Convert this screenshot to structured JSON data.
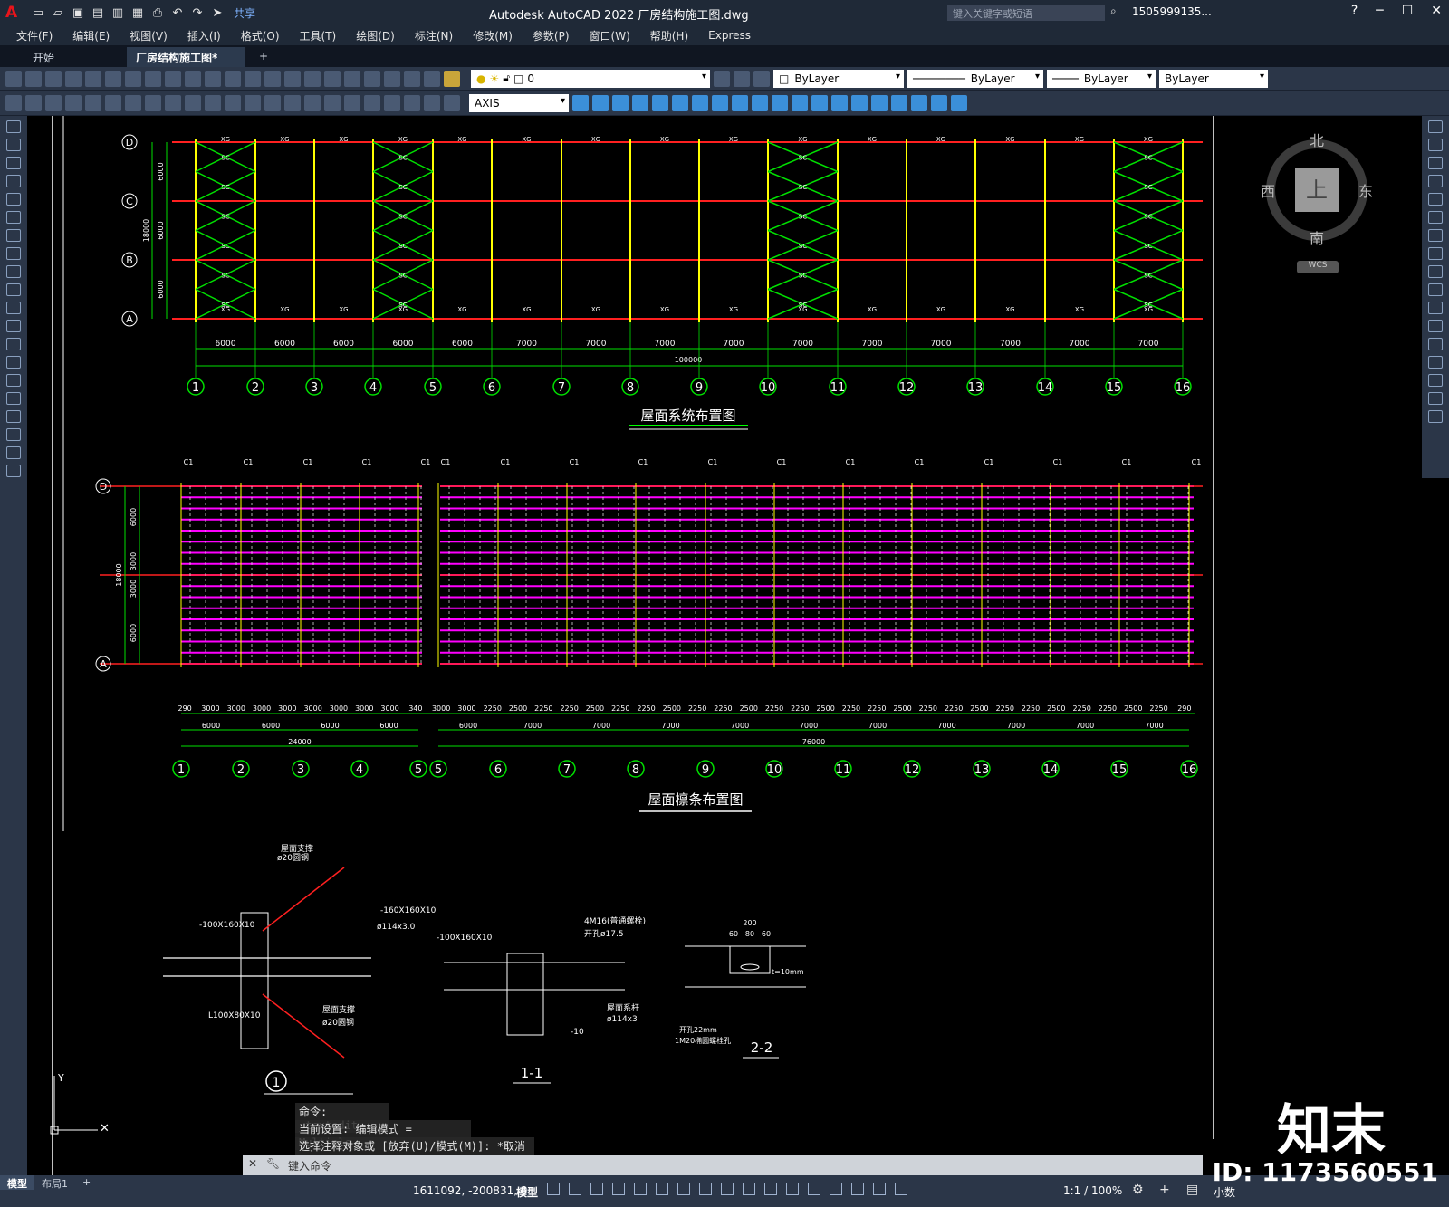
{
  "app": {
    "logo": "A",
    "title": "Autodesk AutoCAD 2022    厂房结构施工图.dwg",
    "search_placeholder": "键入关键字或短语",
    "user": "1505999135...",
    "share": "共享"
  },
  "menu": [
    "文件(F)",
    "编辑(E)",
    "视图(V)",
    "插入(I)",
    "格式(O)",
    "工具(T)",
    "绘图(D)",
    "标注(N)",
    "修改(M)",
    "参数(P)",
    "窗口(W)",
    "帮助(H)",
    "Express"
  ],
  "tabs": {
    "start": "开始",
    "doc": "厂房结构施工图*",
    "close": "✕",
    "add": "+"
  },
  "props": {
    "layer": "0",
    "color": "ByLayer",
    "linetype": "ByLayer",
    "lineweight": "ByLayer",
    "plotstyle": "ByLayer",
    "style": "AXIS"
  },
  "viewcube": {
    "north": "北",
    "south": "南",
    "east": "东",
    "west": "西",
    "top": "上",
    "wcs": "WCS"
  },
  "drawing": {
    "plan1": {
      "title": "屋面系统布置图",
      "rows": [
        "D",
        "C",
        "B",
        "A"
      ],
      "row_dims": [
        "6000",
        "6000",
        "6000"
      ],
      "total_height": "18000",
      "spans": [
        "6000",
        "6000",
        "6000",
        "6000",
        "6000",
        "7000",
        "7000",
        "7000",
        "7000",
        "7000",
        "7000",
        "7000",
        "7000",
        "7000",
        "7000"
      ],
      "total": "100000",
      "axes": [
        "1",
        "2",
        "3",
        "4",
        "5",
        "6",
        "7",
        "8",
        "9",
        "10",
        "11",
        "12",
        "13",
        "14",
        "15",
        "16"
      ]
    },
    "plan2": {
      "title": "屋面檩条布置图",
      "rows": [
        "D",
        "A"
      ],
      "row_dims": [
        "6000",
        "3000",
        "3000",
        "6000"
      ],
      "total_height": "18000",
      "sub_dims": [
        "290",
        "3000",
        "3000",
        "3000",
        "3000",
        "3000",
        "3000",
        "3000",
        "3000",
        "340",
        "3000",
        "3000",
        "2250",
        "2500",
        "2250",
        "2250",
        "2500",
        "2250",
        "2250",
        "2500",
        "2250",
        "2250",
        "2500",
        "2250",
        "2250",
        "2500",
        "2250",
        "2250",
        "2500",
        "2250",
        "2250",
        "2500",
        "2250",
        "2250",
        "2500",
        "2250",
        "2250",
        "2500",
        "2250",
        "290"
      ],
      "spans_left": [
        "6000",
        "6000",
        "6000",
        "6000"
      ],
      "spans_right": [
        "6000",
        "7000",
        "7000",
        "7000",
        "7000",
        "7000",
        "7000",
        "7000",
        "7000",
        "7000",
        "7000"
      ],
      "total_left": "24000",
      "total_right": "76000",
      "axes_left": [
        "1",
        "2",
        "3",
        "4",
        "5"
      ],
      "axes_right": [
        "5",
        "6",
        "7",
        "8",
        "9",
        "10",
        "11",
        "12",
        "13",
        "14",
        "15",
        "16"
      ]
    },
    "details": {
      "d1_label": "1",
      "d1_notes": [
        "屋面支撑",
        "ø20圆钢",
        "-160X160X10",
        "ø114x3.0",
        "-100X160X10",
        "L100X80X10",
        "屋面支撑",
        "ø20圆钢"
      ],
      "d11_label": "1-1",
      "d11_notes": [
        "4M16(普通螺栓)",
        "开孔ø17.5",
        "-100X160X10",
        "屋面系杆",
        "ø114x3",
        "-10"
      ],
      "d22_label": "2-2",
      "d22_notes": [
        "200",
        "60",
        "80",
        "60",
        "t=10mm",
        "开孔22mm",
        "1M20椭圆螺栓孔"
      ]
    }
  },
  "command": {
    "history": [
      "命令: _textedit",
      "当前设置: 编辑模式 = Multiple",
      "选择注释对象或 [放弃(U)/模式(M)]: *取消*"
    ],
    "placeholder": "键入命令"
  },
  "status": {
    "layout_tabs": [
      "模型",
      "布局1",
      "+"
    ],
    "coords": "1611092, -200831, 0",
    "model": "模型",
    "scale": "1:1 / 100%",
    "units": "小数"
  },
  "watermark": {
    "logo": "知末",
    "id": "ID: 1173560551"
  }
}
